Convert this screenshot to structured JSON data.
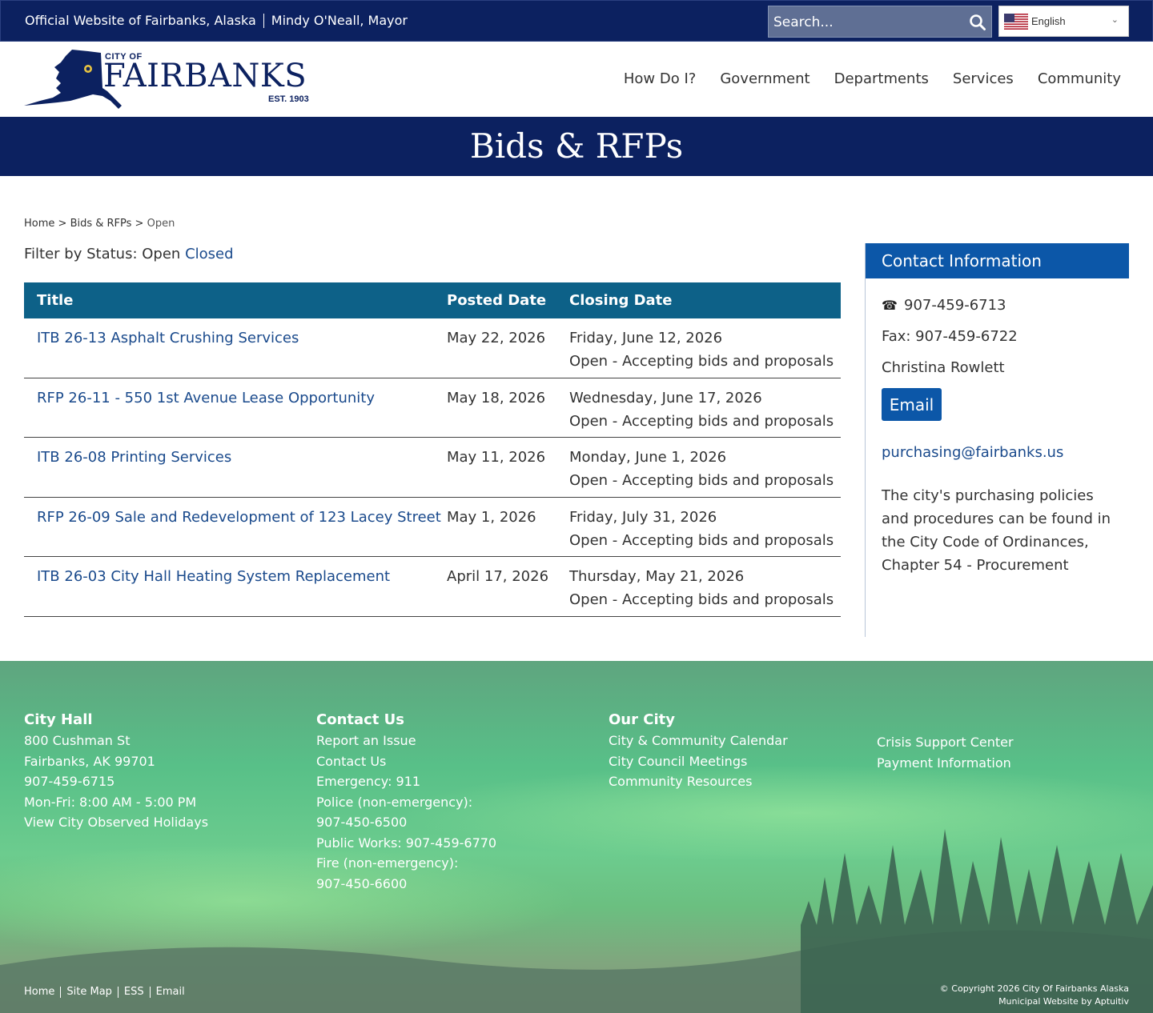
{
  "topbar": {
    "official": "Official Website of Fairbanks, Alaska",
    "mayor": "Mindy O'Neall, Mayor",
    "search_placeholder": "Search...",
    "language": "English"
  },
  "logo": {
    "city_of": "CITY OF",
    "name": "FAIRBANKS",
    "est": "EST. 1903"
  },
  "nav": [
    "How Do I?",
    "Government",
    "Departments",
    "Services",
    "Community"
  ],
  "banner_title": "Bids & RFPs",
  "breadcrumb": [
    "Home",
    "Bids & RFPs",
    "Open"
  ],
  "filter": {
    "label": "Filter by Status: Open",
    "closed_link": "Closed"
  },
  "table": {
    "headers": [
      "Title",
      "Posted Date",
      "Closing Date"
    ],
    "rows": [
      {
        "title": "ITB 26-13 Asphalt Crushing Services",
        "posted": "May 22, 2026",
        "closing": "Friday, June 12, 2026",
        "status": "Open - Accepting bids and proposals"
      },
      {
        "title": "RFP 26-11 - 550 1st Avenue Lease Opportunity",
        "posted": "May 18, 2026",
        "closing": "Wednesday, June 17, 2026",
        "status": "Open - Accepting bids and proposals"
      },
      {
        "title": "ITB 26-08 Printing Services",
        "posted": "May 11, 2026",
        "closing": "Monday, June 1, 2026",
        "status": "Open - Accepting bids and proposals"
      },
      {
        "title": "RFP 26-09 Sale and Redevelopment of 123 Lacey Street",
        "posted": "May 1, 2026",
        "closing": "Friday, July 31, 2026",
        "status": "Open - Accepting bids and proposals"
      },
      {
        "title": "ITB 26-03 City Hall Heating System Replacement",
        "posted": "April 17, 2026",
        "closing": "Thursday, May 21, 2026",
        "status": "Open - Accepting bids and proposals"
      }
    ]
  },
  "contact": {
    "heading": "Contact Information",
    "phone": "907-459-6713",
    "fax": "Fax: 907-459-6722",
    "person": "Christina Rowlett",
    "email_button": "Email",
    "email": "purchasing@fairbanks.us",
    "note": "The city's purchasing policies and procedures can be found in the City Code of Ordinances, Chapter 54 - Procurement"
  },
  "footer": {
    "city_hall": {
      "heading": "City Hall",
      "address1": "800 Cushman St",
      "address2": "Fairbanks, AK 99701",
      "phone": "907-459-6715",
      "hours": "Mon-Fri: 8:00 AM - 5:00 PM",
      "holidays_link": "View City Observed Holidays"
    },
    "contact_us": {
      "heading": "Contact Us",
      "report": "Report an Issue",
      "contact": "Contact Us",
      "emergency": "Emergency: 911",
      "police_label": "Police (non-emergency):",
      "police_phone": "907-450-6500",
      "public_works": "Public Works: 907-459-6770",
      "fire_label": "Fire (non-emergency):",
      "fire_phone": "907-450-6600"
    },
    "our_city": {
      "heading": "Our City",
      "calendar": "City & Community Calendar",
      "council": "City Council Meetings",
      "resources": "Community Resources"
    },
    "more": {
      "crisis": "Crisis Support Center",
      "payment": "Payment Information"
    },
    "bottom_links": [
      "Home",
      "Site Map",
      "ESS",
      "Email"
    ],
    "copyright": "© Copyright 2026 City Of Fairbanks Alaska",
    "credit": "Municipal Website by Aptuitiv"
  },
  "colors": {
    "navy": "#0c2160",
    "table_header": "#0d6188",
    "accent_blue": "#0c57a8",
    "link": "#1a4a8c"
  }
}
